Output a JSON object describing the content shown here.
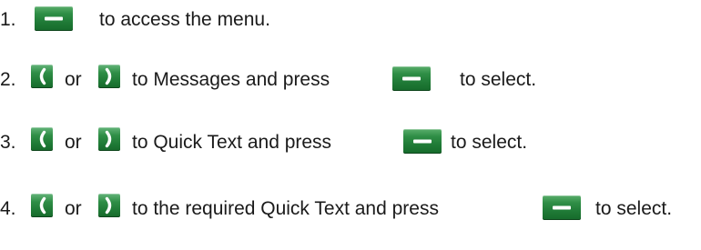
{
  "steps": [
    {
      "number": "1.",
      "menu_key_icon": "menu-soft-key",
      "text": "to access the menu."
    },
    {
      "number": "2.",
      "left_key_icon": "left-arrow-key",
      "or": "or",
      "right_key_icon": "right-arrow-key",
      "text_before": "to Messages and press",
      "menu_key_icon": "menu-soft-key",
      "text_after": "to select."
    },
    {
      "number": "3.",
      "left_key_icon": "left-arrow-key",
      "or": "or",
      "right_key_icon": "right-arrow-key",
      "text_before": "to Quick Text and press",
      "menu_key_icon": "menu-soft-key",
      "text_after": "to select."
    },
    {
      "number": "4.",
      "left_key_icon": "left-arrow-key",
      "or": "or",
      "right_key_icon": "right-arrow-key",
      "text_before": "to the required Quick Text and press",
      "menu_key_icon": "menu-soft-key",
      "text_after": "to select."
    }
  ],
  "colors": {
    "key_green": "#2f8e46",
    "text": "#1a1a1a"
  }
}
